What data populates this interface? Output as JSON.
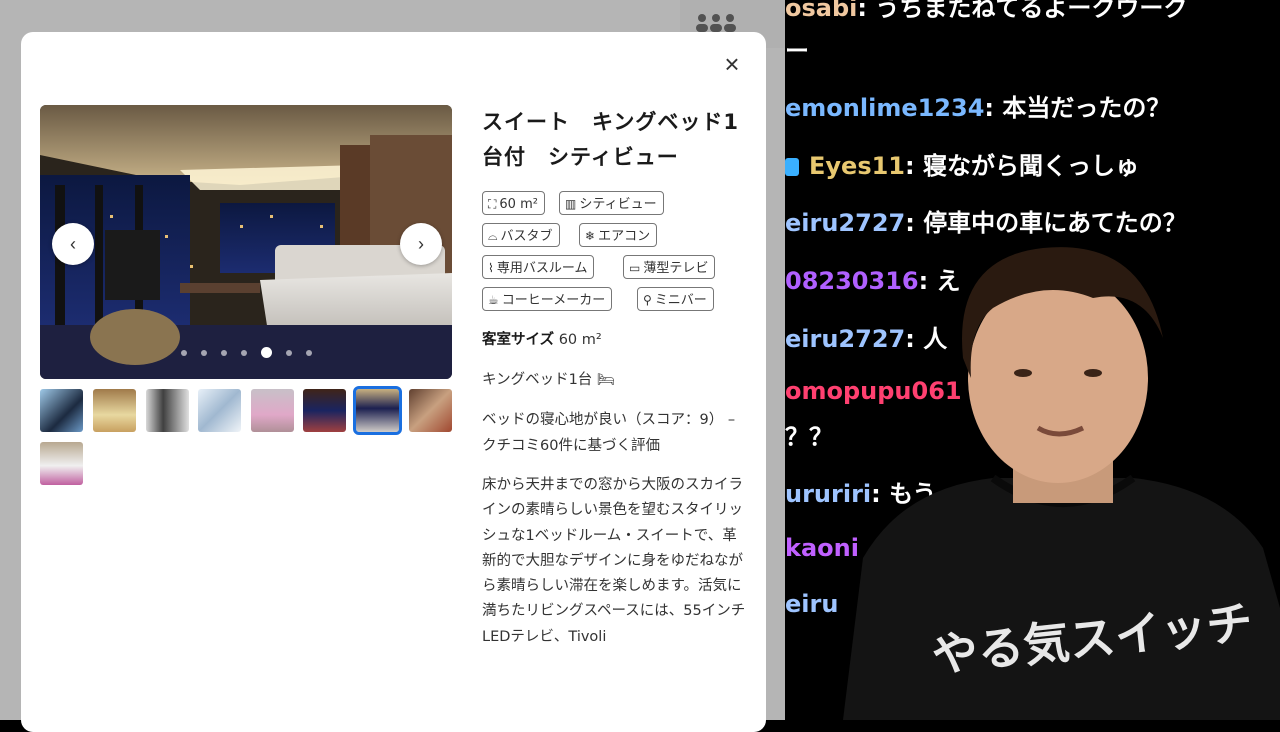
{
  "modal": {
    "close_label": "×",
    "title": "スイート　キングベッド1台付　シティビュー",
    "prev_label": "‹",
    "next_label": "›",
    "carousel": {
      "total_slides": 7,
      "active_slide": 5
    },
    "thumbnail_count": 9,
    "selected_thumbnail": 7,
    "amenities": [
      {
        "icon": "area-icon",
        "label": "60 m²"
      },
      {
        "icon": "city-view-icon",
        "label": "シティビュー"
      },
      {
        "icon": "bathtub-icon",
        "label": "バスタブ"
      },
      {
        "icon": "air-conditioner-icon",
        "label": "エアコン"
      },
      {
        "icon": "private-bathroom-icon",
        "label": "専用バスルーム"
      },
      {
        "icon": "flat-tv-icon",
        "label": "薄型テレビ"
      },
      {
        "icon": "coffee-maker-icon",
        "label": "コーヒーメーカー"
      },
      {
        "icon": "minibar-icon",
        "label": "ミニバー"
      }
    ],
    "room_size_label": "客室サイズ",
    "room_size_value": "60 m²",
    "bed_text": "キングベッド1台",
    "score_text": "ベッドの寝心地が良い（スコア：9） – クチコミ60件に基づく評価",
    "description": "床から天井までの窓から大阪のスカイラインの素晴らしい景色を望むスタイリッシュな1ベッドルーム・スイートで、革新的で大胆なデザインに身をゆだねながら素晴らしい滞在を楽しめます。活気に満ちたリビングスペースには、55インチLEDテレビ、Tivoli"
  },
  "chat": {
    "messages": [
      {
        "user": "osabi",
        "text": ": うちまたねてるよークウーク",
        "color": "#f0c8a0"
      },
      {
        "user": "",
        "text": "ー",
        "color": "#ffffff"
      },
      {
        "user": "emonlime1234",
        "text": ": 本当だったの？",
        "color": "#7ab8ff"
      },
      {
        "user": "Eyes11",
        "text": ": 寝ながら聞くっしゅ",
        "color": "#e8c870"
      },
      {
        "user": "eiru2727",
        "text": ": 停車中の車にあてたの？",
        "color": "#9ec4ff"
      },
      {
        "user": "08230316",
        "text": ": え",
        "color": "#b060ff"
      },
      {
        "user": "eiru2727",
        "text": ": 人",
        "color": "#9ec4ff"
      },
      {
        "user": "omopupu061",
        "text": "",
        "color": "#ff4070"
      },
      {
        "user": "",
        "text": "？？",
        "color": "#ffffff"
      },
      {
        "user": "ururiri",
        "text": ": もう",
        "color": "#9ec4ff"
      },
      {
        "user": "kaoni",
        "text": "",
        "color": "#c060ff"
      },
      {
        "user": "eiru",
        "text": "",
        "color": "#9ec4ff"
      }
    ],
    "shirt_text": "やる気スイッチ"
  }
}
